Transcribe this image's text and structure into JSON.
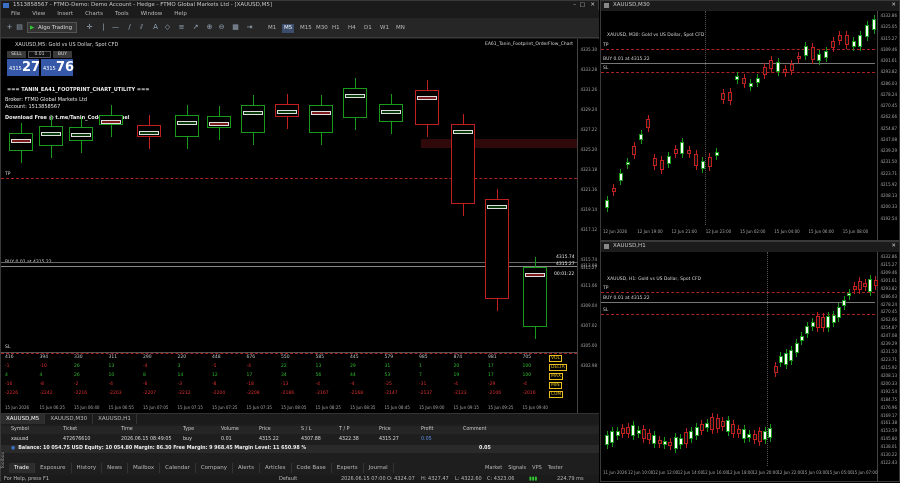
{
  "main": {
    "title": "1513858567 - FTMO-Demo: Demo Account - Hedge - FTMO Global Markets Ltd - [XAUUSD,M5]",
    "menu": [
      "File",
      "View",
      "Insert",
      "Charts",
      "Tools",
      "Window",
      "Help"
    ],
    "algo_trading": "Algo Trading",
    "timeframes": [
      "M1",
      "M5",
      "M15",
      "M30",
      "H1",
      "H4",
      "D1",
      "W1",
      "MN"
    ],
    "active_tf": "M5",
    "chart_header": "XAUUSD,M5: Gold vs US Dollar, Spot CFD",
    "ea_label": "EA61_Tanin_Footprint_OrderFlow_Chart",
    "sell": {
      "label": "SELL",
      "big": "27",
      "small": "4315"
    },
    "buy": {
      "label": "BUY",
      "big": "76",
      "small": "4315"
    },
    "lot": "0.01",
    "utility_title": "=== TANIN_EA41_FOOTPRINT_CHART_UTILITY ===",
    "info_lines": [
      "Broker: FTMO Global Markets Ltd",
      "Account: 1513858567",
      "Download Free @ t.me/Tanin_Coder_Channel"
    ],
    "tp": "TP",
    "sl": "SL",
    "buy_line": "BUY 0.01 at 4315.22",
    "price_labels": [
      "4335.30",
      "4333.28",
      "4331.26",
      "4329.24",
      "4327.22",
      "4325.20",
      "4323.18",
      "4321.16",
      "4319.14",
      "4317.12",
      "4315.74",
      "4315.27",
      "4313.08",
      "4311.06",
      "4309.04",
      "4307.02",
      "4305.00",
      "4302.98"
    ],
    "timer": "00:01:22",
    "cur1": "4315.74",
    "cur2": "4315.27",
    "stats_rows": [
      {
        "name": "VOL",
        "values": [
          "416",
          "394",
          "330",
          "311",
          "290",
          "220",
          "448",
          "676",
          "550",
          "585",
          "445",
          "579",
          "985",
          "874",
          "981",
          "705"
        ]
      },
      {
        "name": "DELTA",
        "values": [
          "-1",
          "-10",
          "26",
          "13",
          "-4",
          "3",
          "-5",
          "-4",
          "22",
          "13",
          "29",
          "31",
          "1",
          "20",
          "17",
          "100"
        ]
      },
      {
        "name": "MAX",
        "values": [
          "4",
          "4",
          "26",
          "10",
          "8",
          "14",
          "12",
          "17",
          "34",
          "56",
          "44",
          "53",
          "7",
          "19",
          "17",
          "100"
        ]
      },
      {
        "name": "MIN",
        "values": [
          "-16",
          "-8",
          "-2",
          "-4",
          "-6",
          "-3",
          "-8",
          "-18",
          "-13",
          "-4",
          "-4",
          "-25",
          "-31",
          "-4",
          "-29",
          "-4"
        ]
      },
      {
        "name": "CUM",
        "values": [
          "-2226",
          "-2242",
          "-2216",
          "-2203",
          "-2207",
          "-2212",
          "-2204",
          "-2208",
          "-2186",
          "-2167",
          "-2168",
          "-2147",
          "-2137",
          "-2123",
          "-2106",
          "-2016"
        ]
      }
    ],
    "time_labels": [
      "15 Jun 2026",
      "15 Jun 06:25",
      "15 Jun 06:40",
      "15 Jun 06:55",
      "15 Jun 07:05",
      "15 Jun 07:15",
      "15 Jun 07:25",
      "15 Jun 07:35",
      "15 Jun 08:05",
      "15 Jun 08:25",
      "15 Jun 08:35",
      "15 Jun 08:45",
      "15 Jun 09:00",
      "15 Jun 09:15",
      "15 Jun 09:25",
      "15 Jun 09:40"
    ],
    "chart_tabs": [
      "XAUUSD,M5",
      "XAUUSD,M30",
      "XAUUSD,H1"
    ],
    "toolbox": {
      "headers": [
        "Symbol",
        "Ticket",
        "Time",
        "Type",
        "Volume",
        "Price",
        "S / L",
        "T / P",
        "Price",
        "Profit",
        "Comment"
      ],
      "row": [
        "xauusd",
        "472676610",
        "2026.06.15 08:49:05",
        "buy",
        "0.01",
        "4315.22",
        "4307.88",
        "4322.38",
        "4315.27",
        "0.05",
        ""
      ],
      "balance": "Balance: 10 054.75 USD  Equity: 10 054.80  Margin: 86.30  Free Margin: 9 968.45  Margin Level: 11 650.98 %",
      "balance_profit": "0.05",
      "tabs": [
        "Trade",
        "Exposure",
        "History",
        "News",
        "Mailbox",
        "Calendar",
        "Company",
        "Alerts",
        "Articles",
        "Code Base",
        "Experts",
        "Journal"
      ],
      "side_label": "Toolbox",
      "right_items": [
        "Market",
        "Signals",
        "VPS",
        "Tester"
      ]
    },
    "status": {
      "help": "For Help, press F1",
      "profile": "Default",
      "datetime": "2026.06.15 07:00",
      "open": "O: 4324.07",
      "high": "H: 4327.47",
      "low": "L: 4322.60",
      "close": "C: 4323.06",
      "traffic": "224.79 ms"
    }
  },
  "m30": {
    "title": "XAUUSD,M30",
    "header": "XAUUSD, M30: Gold vs US Dollar, Spot CFD",
    "tp": "TP",
    "sl": "SL",
    "buy_line": "BUY 0.01 at 4315.22",
    "price_labels": [
      "4332.86",
      "4325.05",
      "4315.27",
      "4309.46",
      "4301.61",
      "4293.82",
      "4286.03",
      "4278.24",
      "4270.45",
      "4262.66",
      "4254.87",
      "4247.08",
      "4239.29",
      "4231.50",
      "4223.71",
      "4215.92",
      "4208.13",
      "4200.33",
      "4192.54"
    ],
    "time_labels": [
      "12 Jun 2026",
      "12 Jun 19:00",
      "12 Jun 21:00",
      "12 Jun 23:00",
      "15 Jun 02:00",
      "15 Jun 04:00",
      "15 Jun 06:00",
      "15 Jun 08:00"
    ]
  },
  "h1": {
    "title": "XAUUSD,H1",
    "header": "XAUUSD, H1: Gold vs US Dollar, Spot CFD",
    "tp": "TP",
    "sl": "SL",
    "buy_line": "BUY 0.01 at 4315.22",
    "price_labels": [
      "4332.86",
      "4315.27",
      "4309.46",
      "4301.61",
      "4293.82",
      "4286.03",
      "4278.24",
      "4270.45",
      "4262.66",
      "4254.87",
      "4247.08",
      "4239.29",
      "4231.50",
      "4223.71",
      "4215.92",
      "4208.13",
      "4200.33",
      "4192.54",
      "4184.75",
      "4176.96",
      "4169.17",
      "4161.38",
      "4153.59",
      "4145.80",
      "4138.01",
      "4130.22",
      "4122.43"
    ],
    "time_labels": [
      "11 Jun 2026",
      "12 Jun 10:00",
      "12 Jun 12:00",
      "12 Jun 14:00",
      "12 Jun 16:00",
      "12 Jun 18:00",
      "12 Jun 20:00",
      "12 Jun 22:00",
      "15 Jun 03:00",
      "15 Jun 05:00",
      "15 Jun 07:00"
    ]
  },
  "colors": {
    "bull": "#ffffff",
    "bear": "#111111",
    "up": "#22aa22",
    "down": "#cc2222",
    "accent": "#3b6fc4"
  }
}
